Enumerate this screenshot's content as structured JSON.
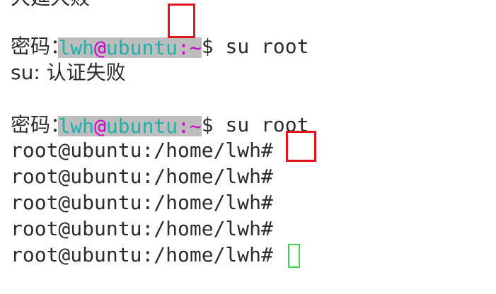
{
  "terminal": {
    "line0": {
      "prompt_user": "lwh",
      "prompt_at": "@",
      "prompt_host": "ubuntu",
      "prompt_colon": ":",
      "prompt_path": "~",
      "prompt_symbol": "$",
      "command": " su root"
    },
    "line1": {
      "text": "密码："
    },
    "line2": {
      "text": "su: 认证失败"
    },
    "line3": {
      "prompt_user": "lwh",
      "prompt_at": "@",
      "prompt_host": "ubuntu",
      "prompt_colon": ":",
      "prompt_path": "~",
      "prompt_symbol": "$",
      "command": " su root"
    },
    "line4": {
      "text": "密码："
    },
    "root_lines": [
      {
        "text": "root@ubuntu:/home/lwh#"
      },
      {
        "text": "root@ubuntu:/home/lwh#"
      },
      {
        "text": "root@ubuntu:/home/lwh#"
      },
      {
        "text": "root@ubuntu:/home/lwh#"
      },
      {
        "text": "root@ubuntu:/home/lwh# "
      }
    ],
    "top_partial": "大延大败"
  },
  "colors": {
    "background": "#ffffff",
    "text": "#2b2b2b",
    "user_host": "#18b3ad",
    "accent_magenta": "#cc00cc",
    "prompt_bg": "#bdbdbd",
    "annotation_red": "#e0141e",
    "cursor_green": "#3ed64e"
  }
}
